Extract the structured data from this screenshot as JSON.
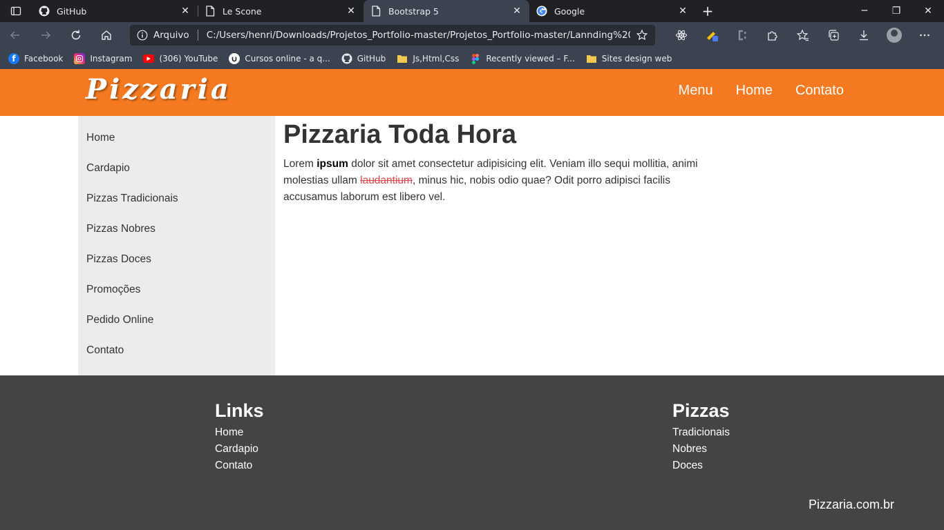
{
  "browser": {
    "tabs": [
      {
        "title": "GitHub",
        "icon": "github-icon",
        "active": false
      },
      {
        "title": "Le Scone",
        "icon": "page-icon",
        "active": false
      },
      {
        "title": "Bootstrap 5",
        "icon": "page-icon",
        "active": true
      },
      {
        "title": "Google",
        "icon": "google-icon",
        "active": false
      }
    ],
    "address": {
      "scheme_label": "Arquivo",
      "url": "C:/Users/henri/Downloads/Projetos_Portfolio-master/Projetos_Portfolio-master/Lannding%20pa..."
    },
    "bookmarks": [
      {
        "label": "Facebook",
        "icon": "facebook-icon"
      },
      {
        "label": "Instagram",
        "icon": "instagram-icon"
      },
      {
        "label": "(306) YouTube",
        "icon": "youtube-icon"
      },
      {
        "label": "Cursos online - a q...",
        "icon": "udemy-icon"
      },
      {
        "label": "GitHub",
        "icon": "github-icon"
      },
      {
        "label": "Js,Html,Css",
        "icon": "folder-icon"
      },
      {
        "label": "Recently viewed – F...",
        "icon": "figma-icon"
      },
      {
        "label": "Sites design web",
        "icon": "folder-icon"
      }
    ]
  },
  "site": {
    "brand": "Pizzaria",
    "colors": {
      "header": "#f47920",
      "footer": "#444444",
      "sidebar": "#ececec"
    },
    "topnav": [
      "Menu",
      "Home",
      "Contato"
    ],
    "sidebar": [
      "Home",
      "Cardapio",
      "Pizzas Tradicionais",
      "Pizzas Nobres",
      "Pizzas Doces",
      "Promoções",
      "Pedido Online",
      "Contato"
    ],
    "main": {
      "heading": "Pizzaria Toda Hora",
      "p_before": "Lorem ",
      "p_bold": "ipsum",
      "p_mid": " dolor sit amet consectetur adipisicing elit. Veniam illo sequi mollitia, animi molestias ullam ",
      "p_strike": "laudantium",
      "p_after": ", minus hic, nobis odio quae? Odit porro adipisci facilis accusamus laborum est libero vel."
    },
    "footer": {
      "links_title": "Links",
      "links": [
        "Home",
        "Cardapio",
        "Contato"
      ],
      "pizzas_title": "Pizzas",
      "pizzas": [
        "Tradicionais",
        "Nobres",
        "Doces"
      ],
      "domain": "Pizzaria.com.br"
    }
  }
}
